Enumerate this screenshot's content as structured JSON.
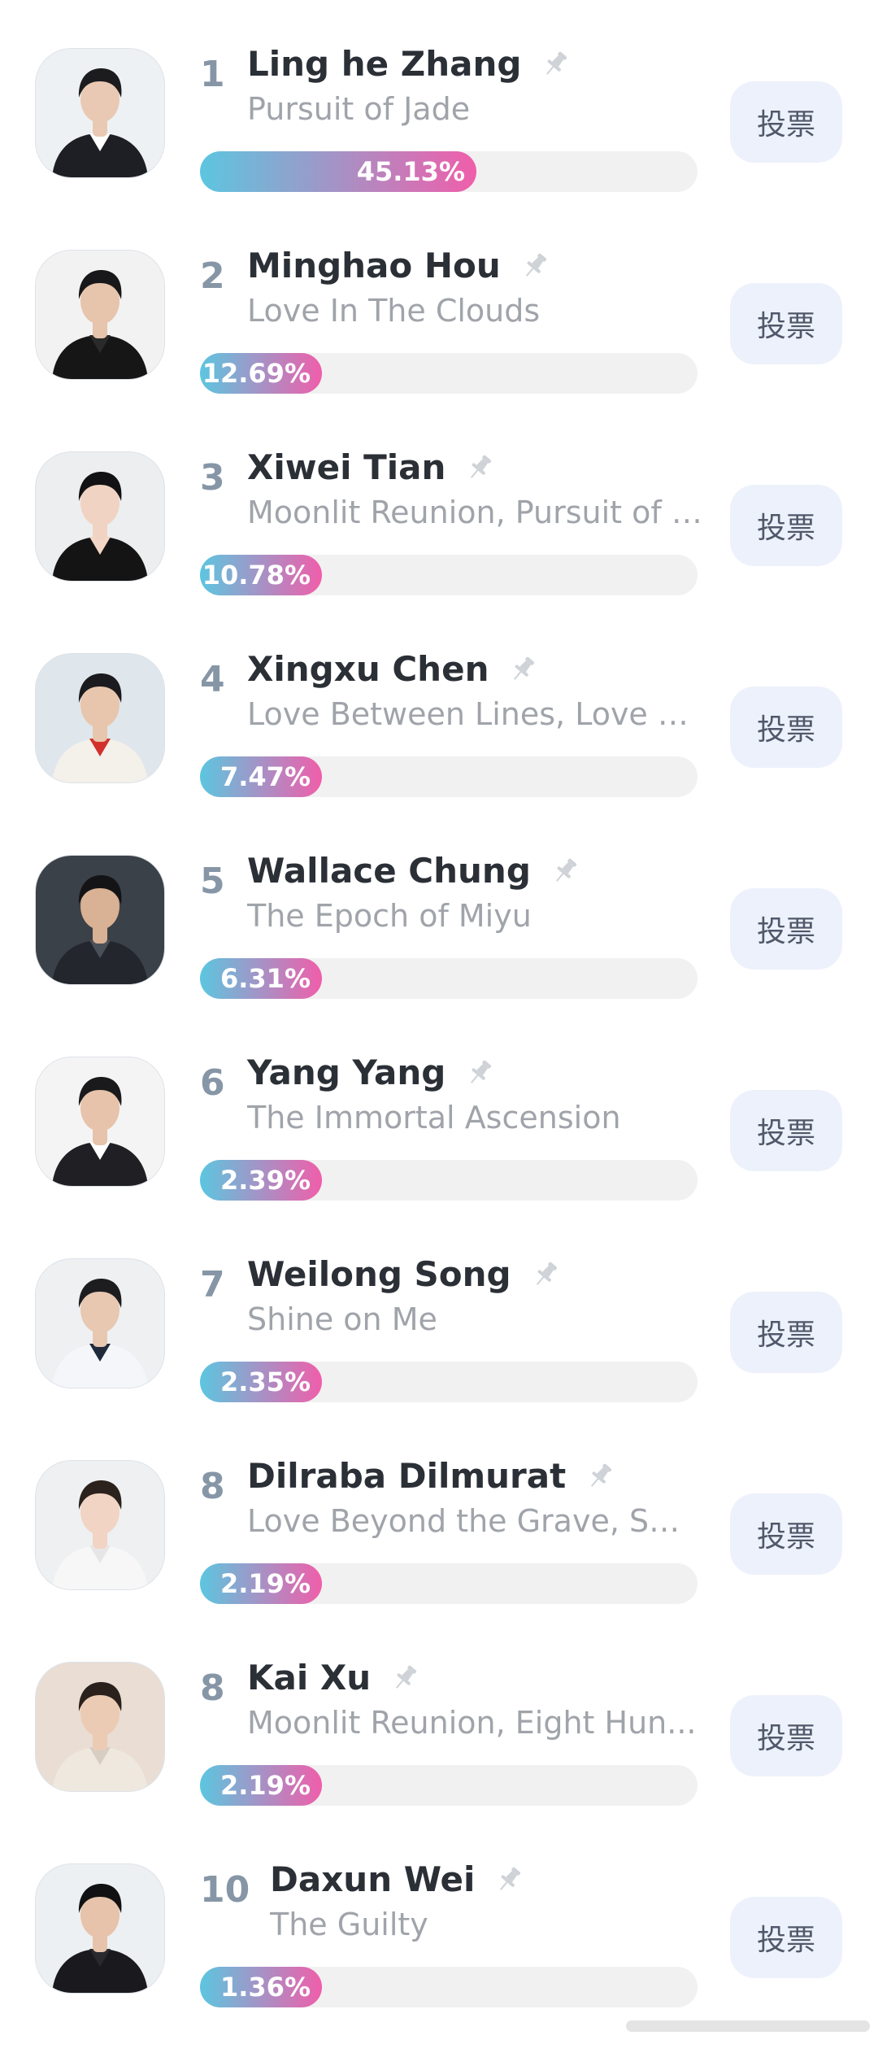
{
  "vote_label": "投票",
  "percent_sign": "%",
  "colors": {
    "bar_start": "#5cc6e0",
    "bar_end": "#f05eaa",
    "track": "#f1f1f1",
    "vote_button_bg": "#edf1fb",
    "rank_text": "#8696a6"
  },
  "icons": {
    "pin": "pin-icon",
    "avatar": "avatar"
  },
  "ranking": [
    {
      "rank": "1",
      "name": "Ling he Zhang",
      "works": "Pursuit of Jade",
      "percent": "45.13",
      "share": 0.4513
    },
    {
      "rank": "2",
      "name": "Minghao Hou",
      "works": "Love In The Clouds",
      "percent": "12.69",
      "share": 0.1269
    },
    {
      "rank": "3",
      "name": "Xiwei Tian",
      "works": "Moonlit Reunion, Pursuit of J...",
      "percent": "10.78",
      "share": 0.1078
    },
    {
      "rank": "4",
      "name": "Xingxu Chen",
      "works": "Love Between Lines, Love O...",
      "percent": "7.47",
      "share": 0.0747
    },
    {
      "rank": "5",
      "name": "Wallace Chung",
      "works": "The Epoch of Miyu",
      "percent": "6.31",
      "share": 0.0631
    },
    {
      "rank": "6",
      "name": "Yang Yang",
      "works": "The Immortal Ascension",
      "percent": "2.39",
      "share": 0.0239
    },
    {
      "rank": "7",
      "name": "Weilong Song",
      "works": "Shine on Me",
      "percent": "2.35",
      "share": 0.0235
    },
    {
      "rank": "8",
      "name": "Dilraba Dilmurat",
      "works": "Love Beyond the Grave, Swo...",
      "percent": "2.19",
      "share": 0.0219
    },
    {
      "rank": "8",
      "name": "Kai Xu",
      "works": "Moonlit Reunion, Eight Hun...",
      "percent": "2.19",
      "share": 0.0219
    },
    {
      "rank": "10",
      "name": "Daxun Wei",
      "works": "The Guilty",
      "percent": "1.36",
      "share": 0.0136
    }
  ]
}
